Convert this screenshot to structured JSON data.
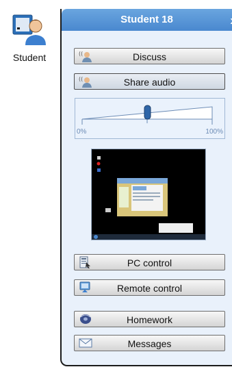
{
  "student_tile": {
    "label": "Student",
    "icon": "student-monitor-icon"
  },
  "panel": {
    "title": "Student 18",
    "close_label": "x",
    "buttons": {
      "discuss": {
        "label": "Discuss",
        "icon": "discuss-headset-icon"
      },
      "share_audio": {
        "label": "Share audio",
        "icon": "share-audio-headset-icon"
      },
      "pc_control": {
        "label": "PC control",
        "icon": "pc-control-icon"
      },
      "remote_control": {
        "label": "Remote control",
        "icon": "remote-control-icon"
      },
      "homework": {
        "label": "Homework",
        "icon": "homework-disk-icon"
      },
      "messages": {
        "label": "Messages",
        "icon": "envelope-icon"
      }
    },
    "volume": {
      "min_label": "0%",
      "max_label": "100%",
      "level": 0.5
    },
    "thumbnail": {
      "description_icon": "screen-thumbnail"
    }
  },
  "colors": {
    "header": "#4a88cf",
    "panel_bg": "#e9f1fb"
  }
}
